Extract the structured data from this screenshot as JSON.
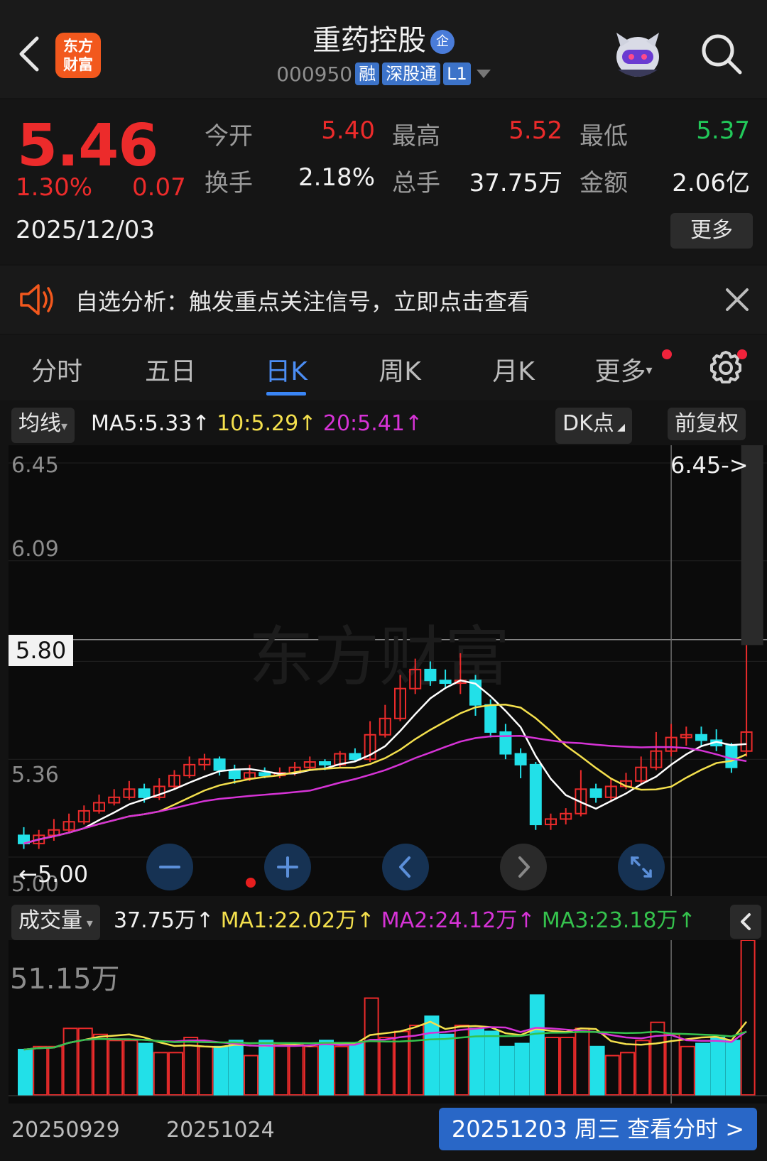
{
  "header": {
    "title": "重药控股",
    "enterprise_badge": "企",
    "logo_text_1": "东方",
    "logo_text_2": "财富",
    "code": "000950",
    "tags": [
      "融",
      "深股通",
      "L1"
    ]
  },
  "quote": {
    "price": "5.46",
    "change_pct": "1.30%",
    "change": "0.07",
    "date": "2025/12/03",
    "open_label": "今开",
    "open": "5.40",
    "high_label": "最高",
    "high": "5.52",
    "low_label": "最低",
    "low": "5.37",
    "turnover_label": "换手",
    "turnover": "2.18%",
    "volume_label": "总手",
    "volume": "37.75万",
    "amount_label": "金额",
    "amount": "2.06亿",
    "more_label": "更多"
  },
  "notice": {
    "text": "自选分析：触发重点关注信号，立即点击查看"
  },
  "tabs": [
    {
      "label": "分时"
    },
    {
      "label": "五日"
    },
    {
      "label": "日K"
    },
    {
      "label": "周K"
    },
    {
      "label": "月K"
    },
    {
      "label": "更多"
    }
  ],
  "ma_bar": {
    "selector": "均线",
    "ma5": "MA5:5.33",
    "ma10": "10:5.29",
    "ma20": "20:5.41",
    "arrow": "↑",
    "dk_label": "DK点",
    "adjust_label": "前复权"
  },
  "price_axis": {
    "labels": [
      "6.45",
      "6.09",
      "5.80",
      "5.36",
      "5.00"
    ],
    "high_marker": "6.45->",
    "low_marker": "←5.00",
    "watermark": "东方财富"
  },
  "volume_bar": {
    "selector": "成交量",
    "vol": "37.75万",
    "ma1": "MA1:22.02万",
    "ma2": "MA2:24.12万",
    "ma3": "MA3:23.18万",
    "max_label": "51.15万"
  },
  "x_axis": {
    "labels": [
      "20250929",
      "20251024"
    ]
  },
  "footer": {
    "detail_label": "20251203 周三 查看分时 >"
  },
  "colors": {
    "up": "#ec2b2b",
    "down": "#22e0e8",
    "ma5": "#ffffff",
    "ma10": "#f4e04d",
    "ma20": "#d633d6",
    "ma3": "#35c24d",
    "accent": "#3a86f7"
  },
  "candles": [
    [
      5.08,
      5.05,
      5.11,
      5.03,
      15
    ],
    [
      5.05,
      5.08,
      5.1,
      5.03,
      16
    ],
    [
      5.08,
      5.1,
      5.14,
      5.06,
      16
    ],
    [
      5.1,
      5.13,
      5.16,
      5.09,
      22
    ],
    [
      5.13,
      5.17,
      5.19,
      5.12,
      22
    ],
    [
      5.17,
      5.2,
      5.23,
      5.16,
      20
    ],
    [
      5.2,
      5.22,
      5.25,
      5.19,
      18
    ],
    [
      5.22,
      5.25,
      5.28,
      5.21,
      18
    ],
    [
      5.25,
      5.22,
      5.27,
      5.2,
      17
    ],
    [
      5.22,
      5.26,
      5.29,
      5.21,
      14
    ],
    [
      5.26,
      5.3,
      5.32,
      5.25,
      14
    ],
    [
      5.3,
      5.34,
      5.37,
      5.29,
      19
    ],
    [
      5.34,
      5.36,
      5.38,
      5.32,
      16
    ],
    [
      5.36,
      5.32,
      5.37,
      5.3,
      16
    ],
    [
      5.32,
      5.29,
      5.34,
      5.27,
      18
    ],
    [
      5.29,
      5.31,
      5.34,
      5.28,
      13
    ],
    [
      5.31,
      5.3,
      5.33,
      5.29,
      18
    ],
    [
      5.3,
      5.31,
      5.33,
      5.29,
      17
    ],
    [
      5.31,
      5.33,
      5.35,
      5.3,
      17
    ],
    [
      5.33,
      5.35,
      5.37,
      5.32,
      16
    ],
    [
      5.35,
      5.34,
      5.36,
      5.32,
      18
    ],
    [
      5.34,
      5.38,
      5.39,
      5.33,
      16
    ],
    [
      5.38,
      5.36,
      5.4,
      5.35,
      17
    ],
    [
      5.36,
      5.45,
      5.5,
      5.35,
      32
    ],
    [
      5.45,
      5.51,
      5.56,
      5.44,
      19
    ],
    [
      5.51,
      5.62,
      5.67,
      5.5,
      21
    ],
    [
      5.62,
      5.69,
      5.73,
      5.6,
      23
    ],
    [
      5.69,
      5.65,
      5.72,
      5.63,
      26
    ],
    [
      5.65,
      5.64,
      5.69,
      5.62,
      20
    ],
    [
      5.64,
      5.65,
      5.75,
      5.6,
      23
    ],
    [
      5.65,
      5.56,
      5.67,
      5.52,
      22
    ],
    [
      5.56,
      5.46,
      5.58,
      5.44,
      21
    ],
    [
      5.46,
      5.38,
      5.49,
      5.36,
      16
    ],
    [
      5.38,
      5.34,
      5.4,
      5.29,
      17
    ],
    [
      5.34,
      5.12,
      5.35,
      5.1,
      33
    ],
    [
      5.12,
      5.14,
      5.16,
      5.1,
      19
    ],
    [
      5.14,
      5.16,
      5.18,
      5.12,
      19
    ],
    [
      5.16,
      5.25,
      5.32,
      5.15,
      22
    ],
    [
      5.25,
      5.22,
      5.27,
      5.2,
      16
    ],
    [
      5.22,
      5.26,
      5.29,
      5.21,
      13
    ],
    [
      5.26,
      5.28,
      5.31,
      5.25,
      14
    ],
    [
      5.28,
      5.33,
      5.37,
      5.27,
      18
    ],
    [
      5.33,
      5.39,
      5.46,
      5.32,
      24
    ],
    [
      5.39,
      5.44,
      5.49,
      5.37,
      20
    ],
    [
      5.44,
      5.45,
      5.48,
      5.41,
      16
    ],
    [
      5.45,
      5.43,
      5.48,
      5.41,
      17
    ],
    [
      5.43,
      5.41,
      5.47,
      5.39,
      19
    ],
    [
      5.41,
      5.33,
      5.42,
      5.31,
      18
    ],
    [
      5.39,
      5.46,
      5.78,
      5.37,
      51.15
    ]
  ]
}
